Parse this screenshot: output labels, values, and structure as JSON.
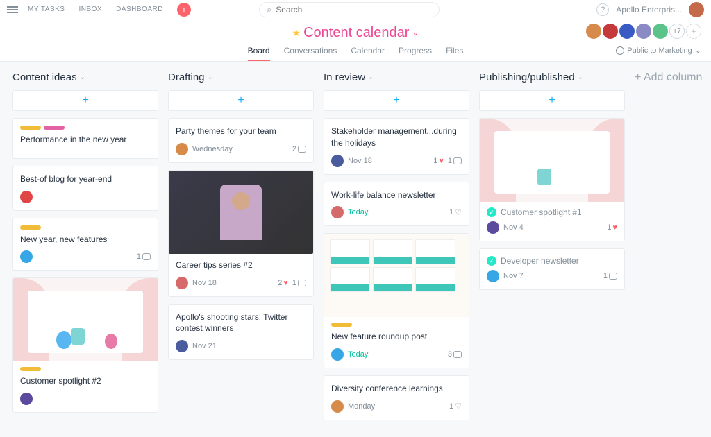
{
  "nav": {
    "my_tasks": "MY TASKS",
    "inbox": "INBOX",
    "dashboard": "DASHBOARD"
  },
  "search": {
    "placeholder": "Search"
  },
  "workspace": "Apollo Enterpris...",
  "project": {
    "title": "Content calendar",
    "visibility": "Public to Marketing"
  },
  "tabs": [
    "Board",
    "Conversations",
    "Calendar",
    "Progress",
    "Files"
  ],
  "members_overflow": "+7",
  "add_column_label": "+ Add column",
  "columns": [
    {
      "name": "Content ideas",
      "cards": [
        {
          "tags": [
            "#f1bd38",
            "#e362a4"
          ],
          "title": "Performance in the new year"
        },
        {
          "title": "Best-of blog for year-end",
          "avatar": "#e04646"
        },
        {
          "tags": [
            "#f1bd38"
          ],
          "title": "New year, new features",
          "avatar": "#37a6e6",
          "comments": 1
        },
        {
          "cover": "illustration",
          "tags": [
            "#f1bd38"
          ],
          "title": "Customer spotlight #2",
          "avatar": "#5b4a9e"
        }
      ]
    },
    {
      "name": "Drafting",
      "cards": [
        {
          "title": "Party themes for your team",
          "avatar": "#d68b4a",
          "date": "Wednesday",
          "comments": 2
        },
        {
          "cover": "photo",
          "title": "Career tips series #2",
          "avatar": "#d66a6a",
          "date": "Nov 18",
          "likes": 2,
          "comments": 1
        },
        {
          "title": "Apollo's shooting stars: Twitter contest winners",
          "avatar": "#4a5b9e",
          "date": "Nov 21"
        }
      ]
    },
    {
      "name": "In review",
      "cards": [
        {
          "title": "Stakeholder management...during the holidays",
          "avatar": "#4a5b9e",
          "date": "Nov 18",
          "likes": 1,
          "comments": 1
        },
        {
          "title": "Work-life balance newsletter",
          "avatar": "#d66a6a",
          "date": "Today",
          "date_green": true,
          "empty_like": true
        },
        {
          "cover": "dashboard",
          "tags": [
            "#f1bd38"
          ],
          "title": "New feature roundup post",
          "avatar": "#37a6e6",
          "date": "Today",
          "date_green": true,
          "comments": 3
        },
        {
          "title": "Diversity conference learnings",
          "avatar": "#d68b4a",
          "date": "Monday",
          "empty_like": true
        }
      ]
    },
    {
      "name": "Publishing/published",
      "cards": [
        {
          "cover": "illustration2",
          "completed": true,
          "title": "Customer spotlight #1",
          "avatar": "#5b4a9e",
          "date": "Nov 4",
          "likes": 1
        },
        {
          "completed": true,
          "title": "Developer newsletter",
          "avatar": "#37a6e6",
          "date": "Nov 7",
          "comments": 1
        }
      ]
    }
  ]
}
